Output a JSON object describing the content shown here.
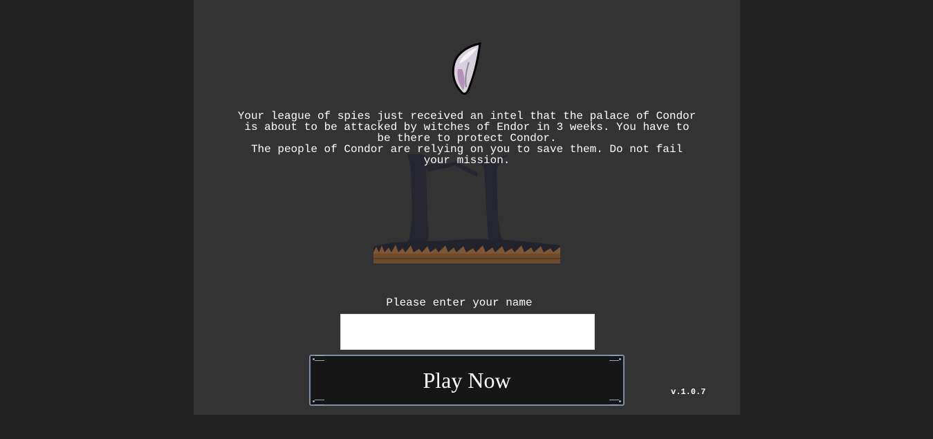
{
  "intro": {
    "paragraph1": "Your league of spies just received an intel that the palace of Condor is about to be attacked by witches of Endor in 3 weeks. You have to be there to protect Condor.",
    "paragraph2": "The people of Condor are relying on you to save them. Do not fail your mission."
  },
  "name_form": {
    "label": "Please enter your name",
    "value": "",
    "placeholder": ""
  },
  "play_button": {
    "label": "Play Now"
  },
  "version": "v.1.0.7",
  "icons": {
    "logo": "fang-icon",
    "scene": "dead-trees-illustration"
  },
  "colors": {
    "page_background": "#222222",
    "panel_background": "#333333",
    "button_background": "#161616",
    "button_border": "#7d8da8",
    "text": "#ffffff"
  }
}
